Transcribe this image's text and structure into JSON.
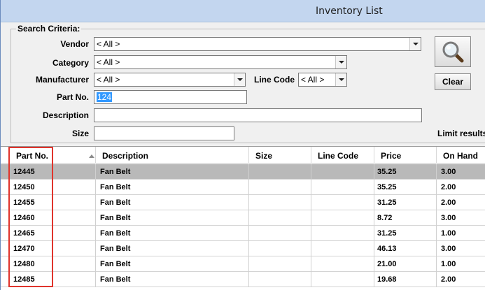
{
  "window": {
    "title": "Inventory List"
  },
  "criteria": {
    "legend": "Search Criteria:",
    "vendor": {
      "label": "Vendor",
      "value": "< All >"
    },
    "category": {
      "label": "Category",
      "value": "< All >"
    },
    "manufacturer": {
      "label": "Manufacturer",
      "value": "< All >"
    },
    "line_code": {
      "label": "Line Code",
      "value": "< All >"
    },
    "part_no": {
      "label": "Part No.",
      "value": "124"
    },
    "description": {
      "label": "Description",
      "value": ""
    },
    "size": {
      "label": "Size",
      "value": ""
    },
    "clear_label": "Clear",
    "limit_text": "Limit results",
    "search_icon": "magnifier-icon"
  },
  "grid": {
    "columns": [
      "Part No.",
      "Description",
      "Size",
      "Line Code",
      "Price",
      "On Hand"
    ],
    "rows": [
      {
        "part": "12445",
        "desc": "Fan Belt",
        "size": "",
        "line": "",
        "price": "35.25",
        "onhand": "3.00"
      },
      {
        "part": "12450",
        "desc": "Fan Belt",
        "size": "",
        "line": "",
        "price": "35.25",
        "onhand": "2.00"
      },
      {
        "part": "12455",
        "desc": "Fan Belt",
        "size": "",
        "line": "",
        "price": "31.25",
        "onhand": "2.00"
      },
      {
        "part": "12460",
        "desc": "Fan Belt",
        "size": "",
        "line": "",
        "price": "8.72",
        "onhand": "3.00"
      },
      {
        "part": "12465",
        "desc": "Fan Belt",
        "size": "",
        "line": "",
        "price": "31.25",
        "onhand": "1.00"
      },
      {
        "part": "12470",
        "desc": "Fan Belt",
        "size": "",
        "line": "",
        "price": "46.13",
        "onhand": "3.00"
      },
      {
        "part": "12480",
        "desc": "Fan Belt",
        "size": "",
        "line": "",
        "price": "21.00",
        "onhand": "1.00"
      },
      {
        "part": "12485",
        "desc": "Fan Belt",
        "size": "",
        "line": "",
        "price": "19.68",
        "onhand": "2.00"
      }
    ],
    "selected_index": 0,
    "highlight_color": "#e0342c"
  }
}
